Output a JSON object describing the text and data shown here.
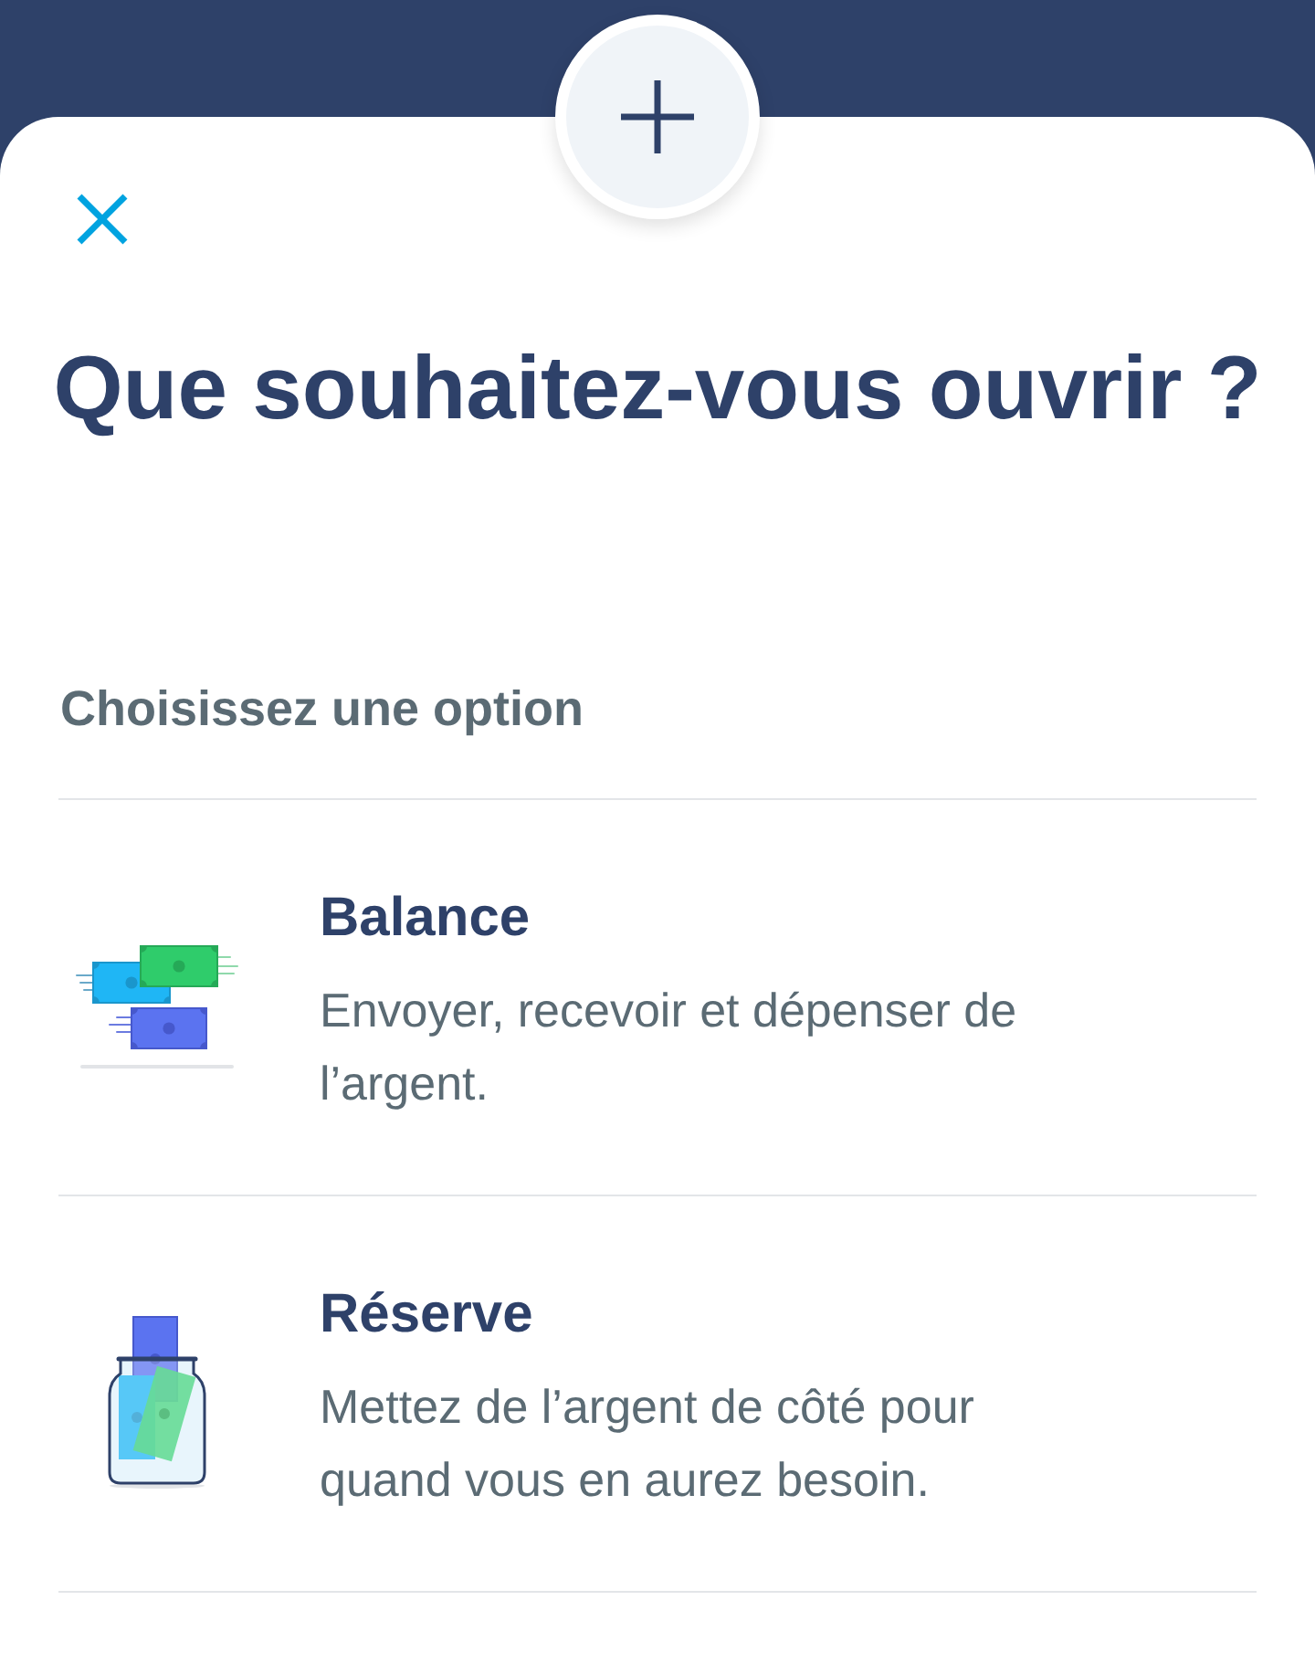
{
  "title": "Que souhaitez-vous ouvrir ?",
  "subtitle": "Choisissez une option",
  "options": [
    {
      "kind": "balance",
      "title": "Balance",
      "description": "Envoyer, recevoir et dépenser de l’argent."
    },
    {
      "kind": "reserve",
      "title": "Réserve",
      "description": "Mettez de l’argent de côté pour quand vous en aurez besoin."
    }
  ]
}
